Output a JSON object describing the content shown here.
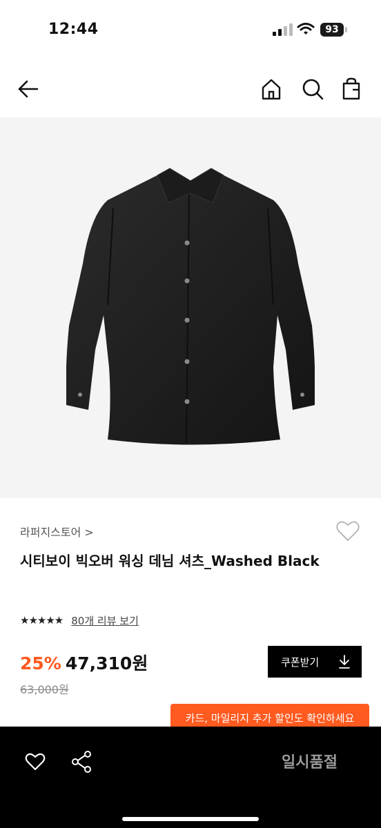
{
  "status_bar": {
    "time": "12:44",
    "battery": "93"
  },
  "nav": {
    "icons": [
      "back-arrow-icon",
      "home-icon",
      "search-icon",
      "shopping-bag-icon"
    ]
  },
  "product": {
    "store": "라퍼지스토어 >",
    "title": "시티보이 빅오버 워싱 데님 셔츠_Washed Black",
    "stars": "★★★★★",
    "review_link": "80개 리뷰 보기",
    "discount": "25%",
    "price": "47,310원",
    "original_price": "63,000원",
    "coupon_label": "쿠폰받기"
  },
  "promo": {
    "text": "카드, 마일리지 추가 할인도 확인하세요"
  },
  "bottom_bar": {
    "status": "일시품절"
  },
  "colors": {
    "accent": "#ff5a1f",
    "bottom_bar": "#000000",
    "image_bg": "#f4f4f4"
  }
}
